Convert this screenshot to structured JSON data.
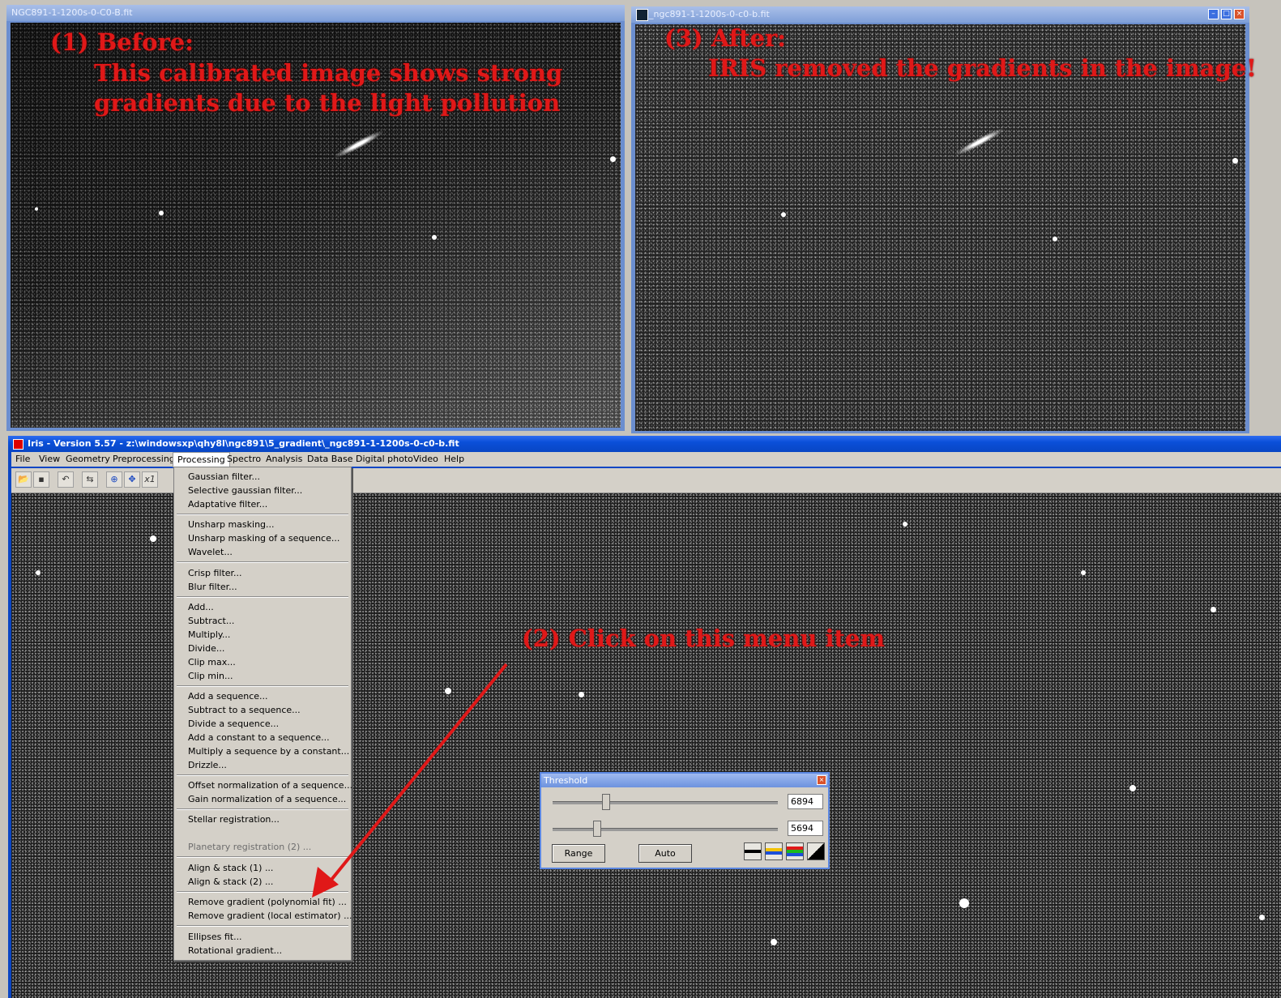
{
  "window_before": {
    "title": "NGC891-1-1200s-0-C0-B.fit"
  },
  "window_after": {
    "title": "_ngc891-1-1200s-0-c0-b.fit"
  },
  "annotations": {
    "before_line1": "(1) Before:",
    "before_line2": "This calibrated image shows strong",
    "before_line3": "gradients due to the light pollution",
    "after_line1": "(3) After:",
    "after_line2": "IRIS removed the gradients in the image!",
    "click": "(2) Click on this menu item"
  },
  "app": {
    "title": "Iris - Version 5.57 - z:\\windowsxp\\qhy8l\\ngc891\\5_gradient\\_ngc891-1-1200s-0-c0-b.fit",
    "menu": [
      "File",
      "View",
      "Geometry",
      "Preprocessing",
      "Processing",
      "Spectro",
      "Analysis",
      "Data Base",
      "Digital photo",
      "Video",
      "Help"
    ]
  },
  "toolbar": {
    "x1_label": "x1"
  },
  "processing_menu": {
    "items": [
      "Gaussian filter...",
      "Selective gaussian filter...",
      "Adaptative filter...",
      "Unsharp masking...",
      "Unsharp masking of a sequence...",
      "Wavelet...",
      "Crisp filter...",
      "Blur filter...",
      "Add...",
      "Subtract...",
      "Multiply...",
      "Divide...",
      "Clip max...",
      "Clip min...",
      "Add a sequence...",
      "Subtract to a sequence...",
      "Divide a sequence...",
      "Add a constant to a sequence...",
      "Multiply a sequence by a constant...",
      "Drizzle...",
      "Offset normalization of a sequence...",
      "Gain normalization of a sequence...",
      "Stellar registration...",
      "Planetary registration (2) ...",
      "Align & stack (1) ...",
      "Align & stack (2) ...",
      "Remove gradient (polynomial fit) ...",
      "Remove gradient (local estimator) ...",
      "Ellipses fit...",
      "Rotational gradient..."
    ]
  },
  "threshold": {
    "title": "Threshold",
    "high_value": "6894",
    "low_value": "5694",
    "high_level": 0.22,
    "low_level": 0.18,
    "range_label": "Range",
    "auto_label": "Auto"
  },
  "colors": {
    "annotation": "#e01818",
    "arrow": "#e01818"
  }
}
